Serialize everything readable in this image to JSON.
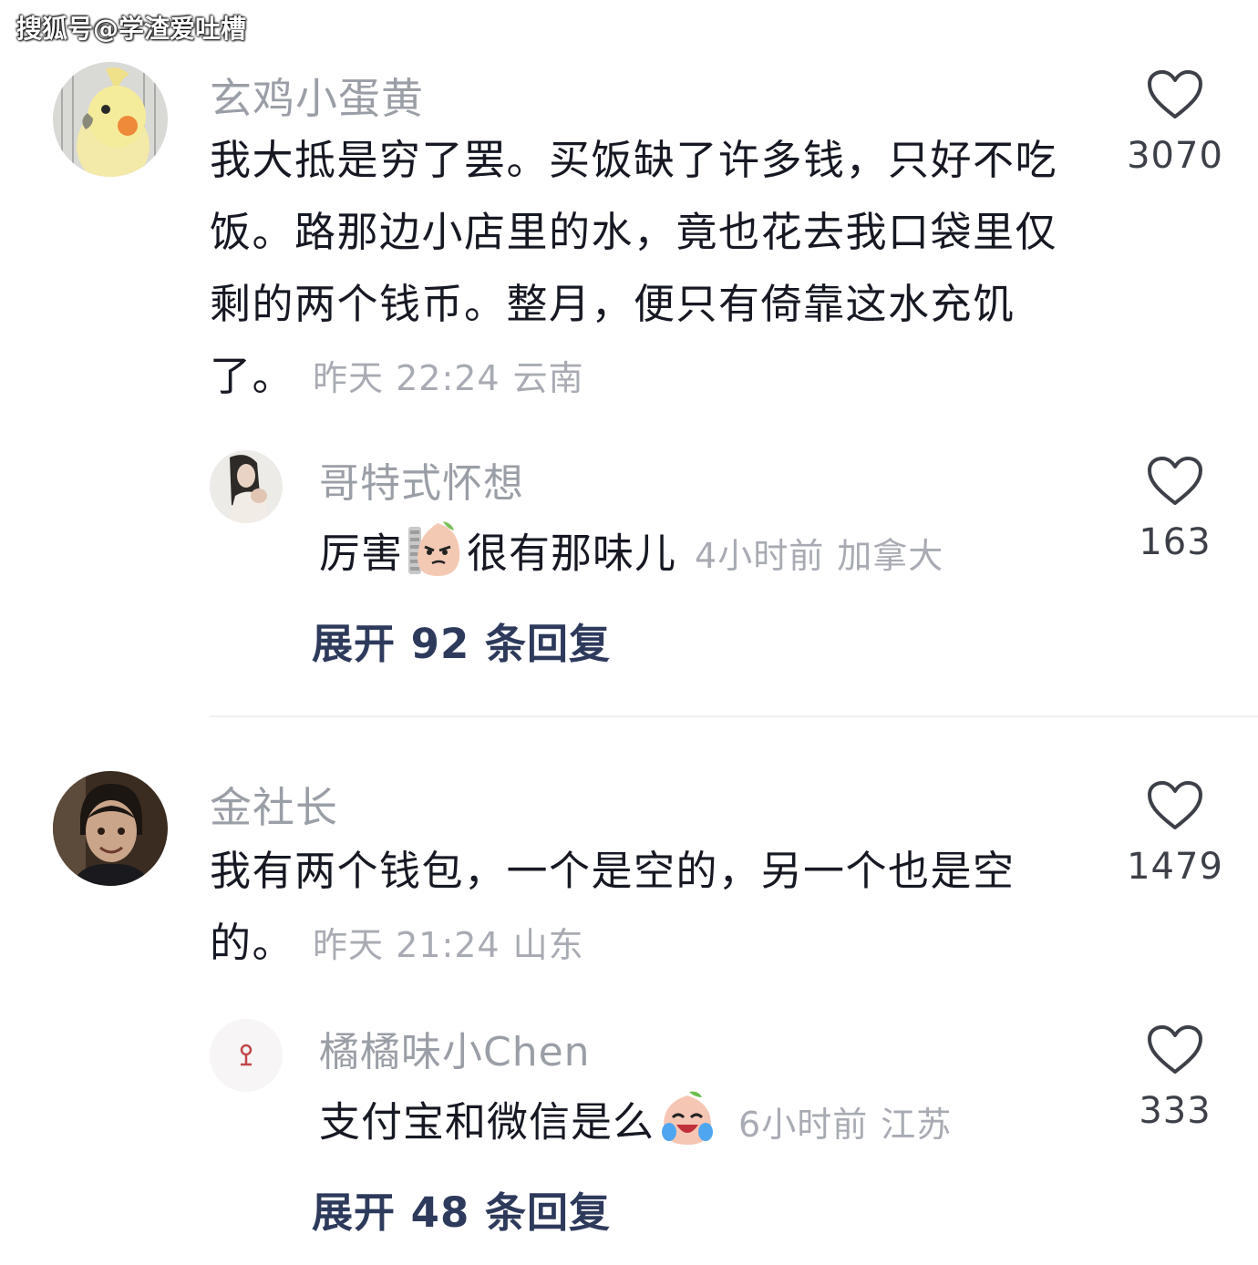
{
  "watermark": "搜狐号@学渣爱吐槽",
  "comments": [
    {
      "username": "玄鸡小蛋黄",
      "text": "我大抵是穷了罢。买饭缺了许多钱，只好不吃饭。路那边小店里的水，竟也花去我口袋里仅剩的两个钱币。整月，便只有倚靠这水充饥了。",
      "time": "昨天 22:24",
      "location": "云南",
      "likes": "3070",
      "reply": {
        "username": "哥特式怀想",
        "text_before": "厉害",
        "text_after": "很有那味儿",
        "emoji": "smirk-peach-emoji",
        "time": "4小时前",
        "location": "加拿大",
        "likes": "163"
      },
      "expand_label": "展开 92 条回复"
    },
    {
      "username": "金社长",
      "text": "我有两个钱包，一个是空的，另一个也是空的。",
      "time": "昨天 21:24",
      "location": "山东",
      "likes": "1479",
      "reply": {
        "username": "橘橘味小Chen",
        "text_before": "支付宝和微信是么",
        "text_after": "",
        "emoji": "laugh-cry-peach-emoji",
        "time": "6小时前",
        "location": "江苏",
        "likes": "333"
      },
      "expand_label": "展开 48 条回复"
    }
  ],
  "colors": {
    "username": "#9a9ea6",
    "text": "#161823",
    "meta": "#a8abb3",
    "expand": "#2e3a5c"
  }
}
